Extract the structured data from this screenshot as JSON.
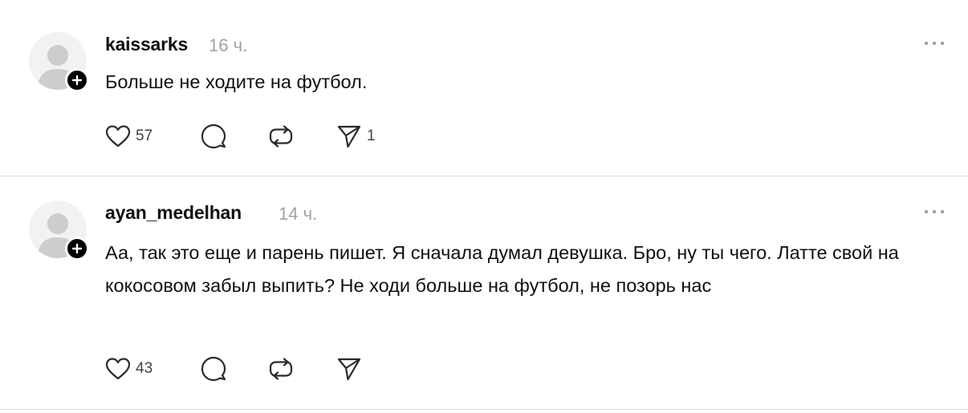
{
  "posts": [
    {
      "username": "kaissarks",
      "time": "16 ч.",
      "text": "Больше не ходите на футбол.",
      "likes": "57",
      "shares": "1"
    },
    {
      "username": "ayan_medelhan",
      "time": "14 ч.",
      "text": "Аа, так это еще и парень пишет. Я сначала думал девушка. Бро, ну ты чего. Латте свой на кокосовом забыл выпить? Не ходи больше на футбол, не позорь нас",
      "likes": "43",
      "shares": ""
    }
  ],
  "icons": {
    "like": "heart-icon",
    "reply": "comment-icon",
    "repost": "repost-icon",
    "share": "send-icon",
    "more": "more-icon",
    "follow": "plus-icon"
  },
  "colors": {
    "text": "#101010",
    "muted": "#a2a2a2",
    "divider": "#dcdcdc",
    "avatar_bg": "#f2f2f2",
    "avatar_fg": "#cdcdcd"
  }
}
